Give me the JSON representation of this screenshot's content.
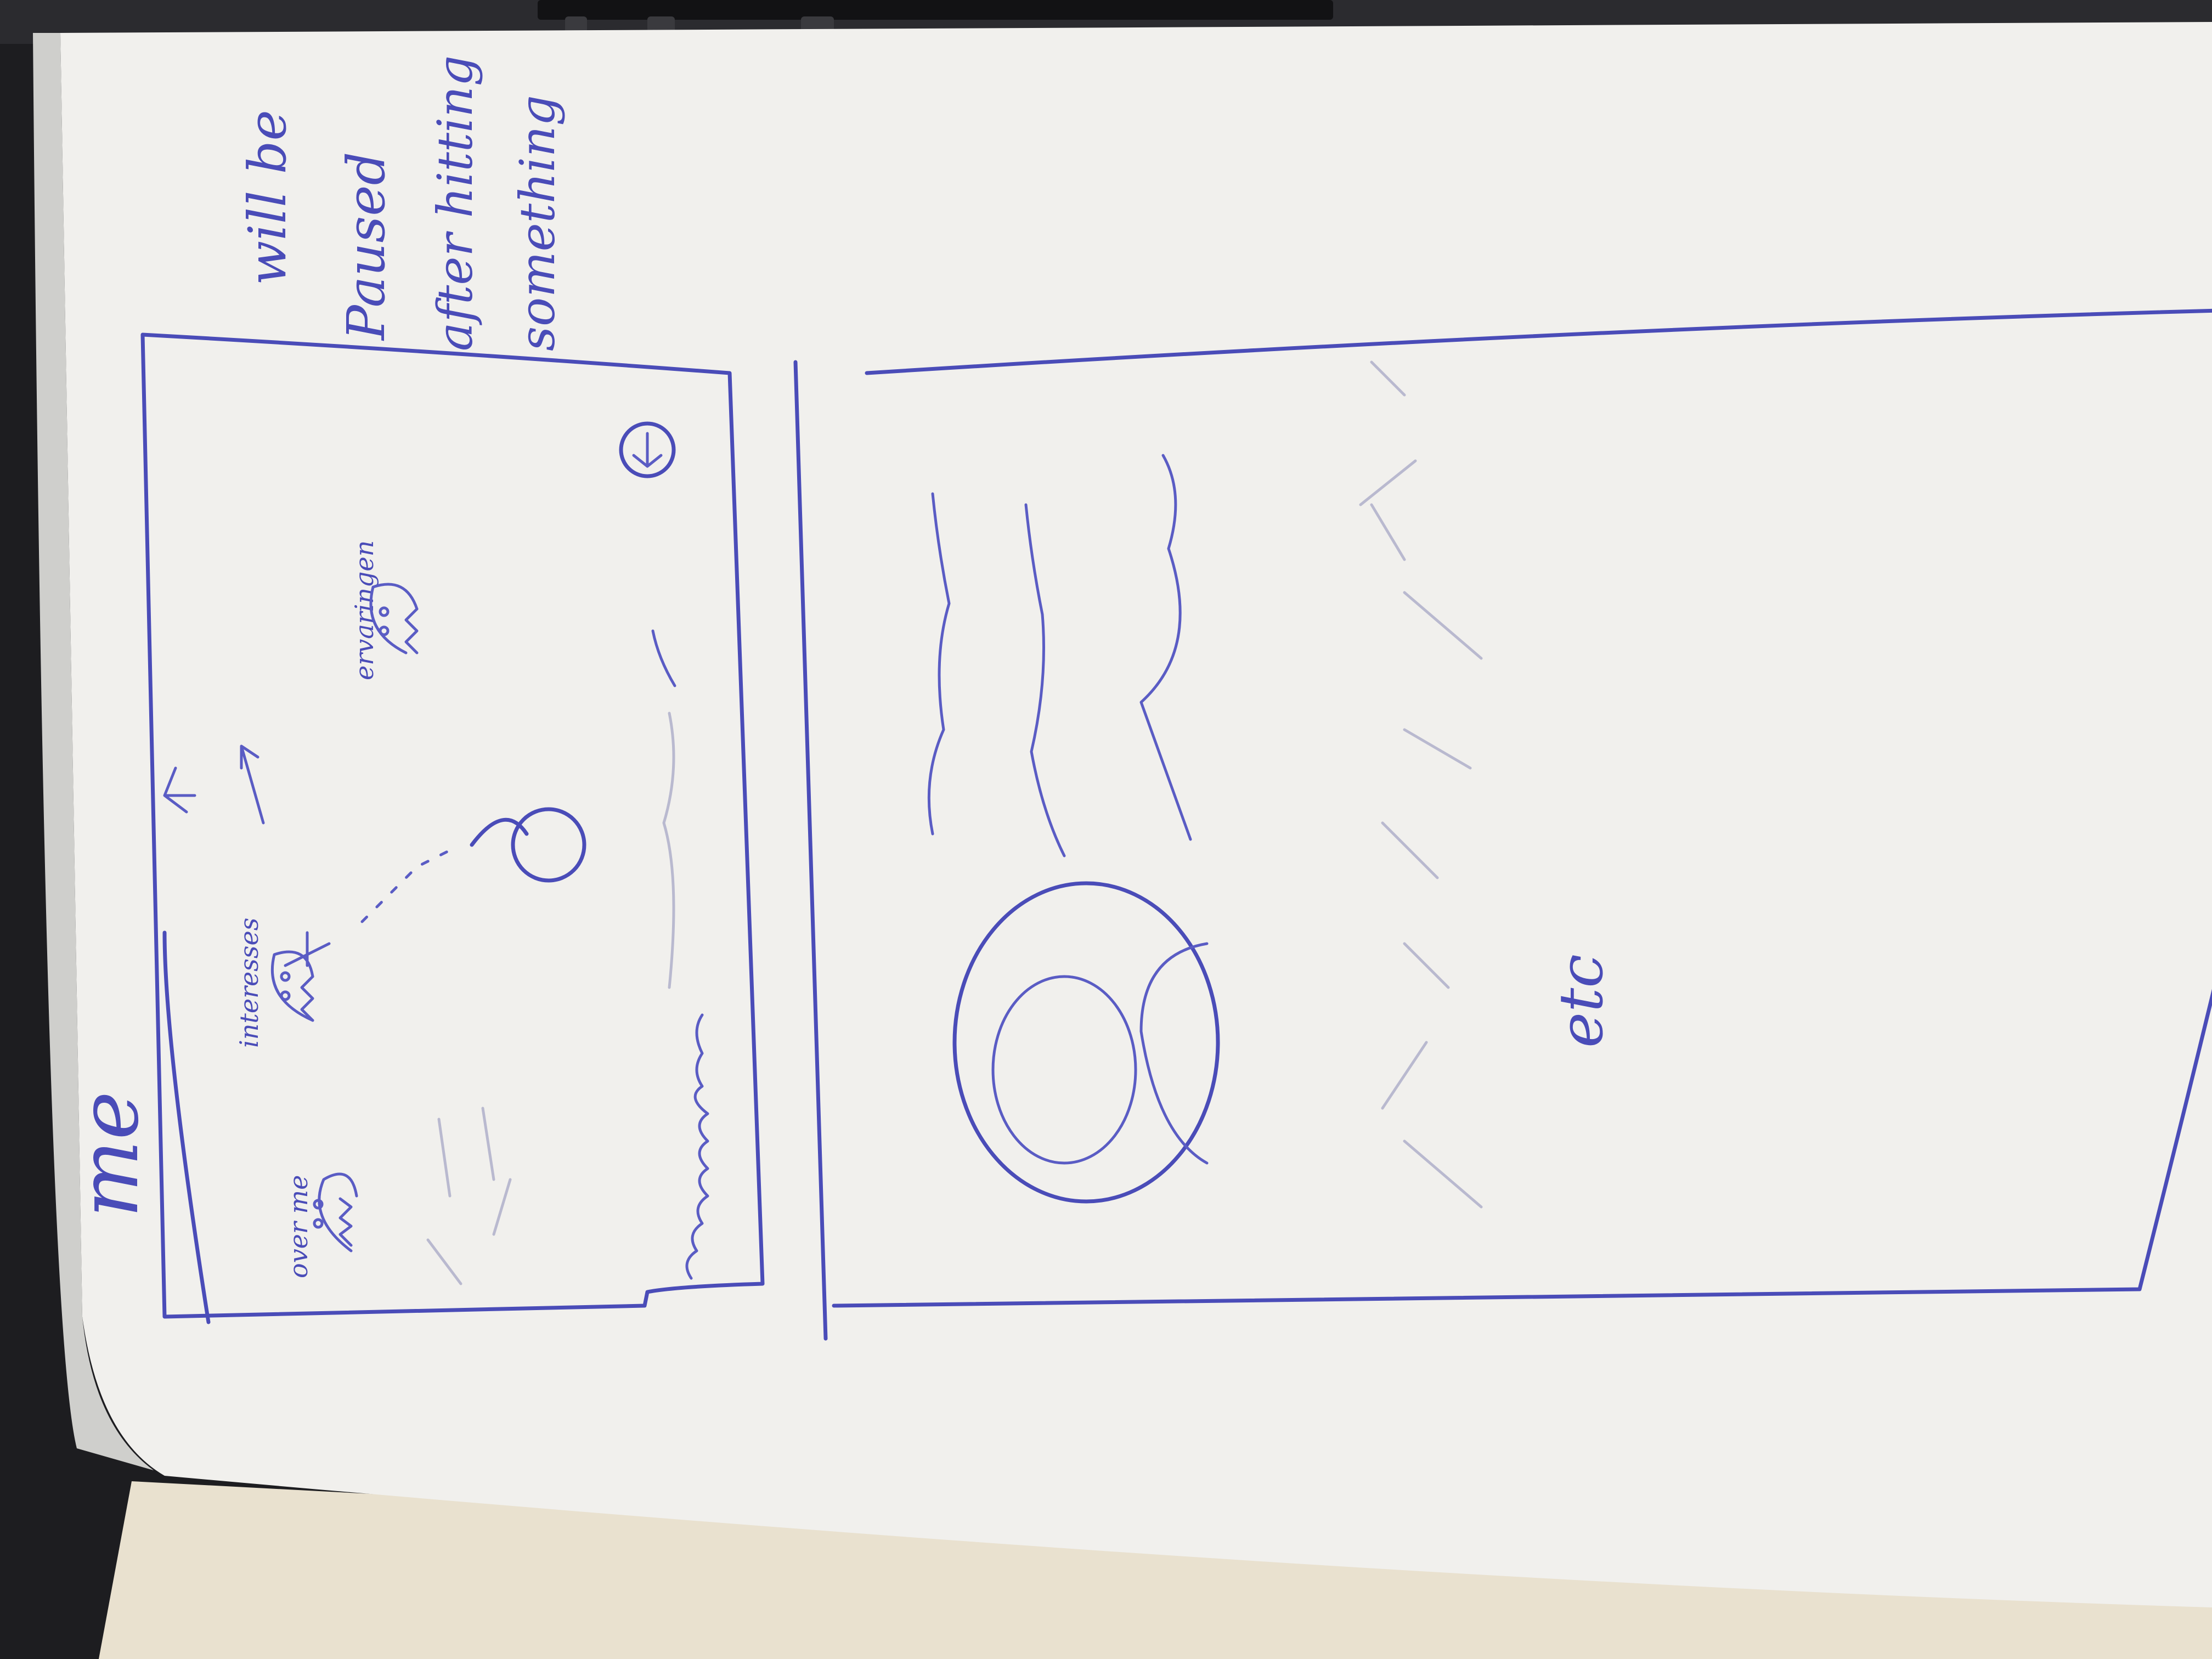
{
  "sketch": {
    "title": "me",
    "icon_labels": [
      "over me",
      "interesses",
      "ervaringen"
    ],
    "note_lines": [
      "will be",
      "Paused",
      "after hitting",
      "something"
    ],
    "footer_text": "etc",
    "colors": {
      "ink": "#4a4cb8",
      "paper": "#f1f0ed",
      "background": "#1d1d20"
    }
  }
}
